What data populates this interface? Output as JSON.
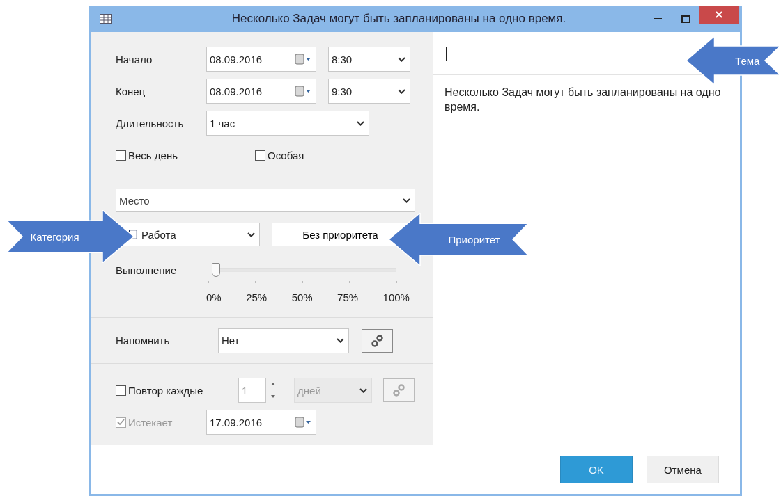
{
  "window": {
    "title": "Несколько Задач могут быть запланированы на одно время."
  },
  "start": {
    "label": "Начало",
    "date": "08.09.2016",
    "time": "8:30"
  },
  "end": {
    "label": "Конец",
    "date": "08.09.2016",
    "time": "9:30"
  },
  "duration": {
    "label": "Длительность",
    "value": "1 час"
  },
  "options": [
    {
      "label": "Весь день",
      "checked": false
    },
    {
      "label": "Особая",
      "checked": false
    }
  ],
  "location": {
    "placeholder": "Место"
  },
  "category": {
    "value": "Работа"
  },
  "priority": {
    "label": "Без приоритета"
  },
  "progress": {
    "label": "Выполнение",
    "level": 0,
    "ticks": [
      "0%",
      "25%",
      "50%",
      "75%",
      "100%"
    ]
  },
  "reminder": {
    "label": "Напомнить",
    "value": "Нет"
  },
  "recurrence": {
    "label": "Повтор каждые",
    "checked": false,
    "count": "1",
    "unit": "дней",
    "disabled": true
  },
  "expires": {
    "label": "Истекает",
    "checked": true,
    "disabled": true,
    "date": "17.09.2016"
  },
  "description": "Несколько Задач могут быть запланированы на одно время.",
  "buttons": [
    {
      "label": "OK",
      "kind": "primary"
    },
    {
      "label": "Отмена",
      "kind": "secondary"
    }
  ],
  "callouts": [
    {
      "label": "Тема",
      "kind": "left"
    },
    {
      "label": "Категория",
      "kind": "right"
    },
    {
      "label": "Приоритет",
      "kind": "left"
    }
  ]
}
